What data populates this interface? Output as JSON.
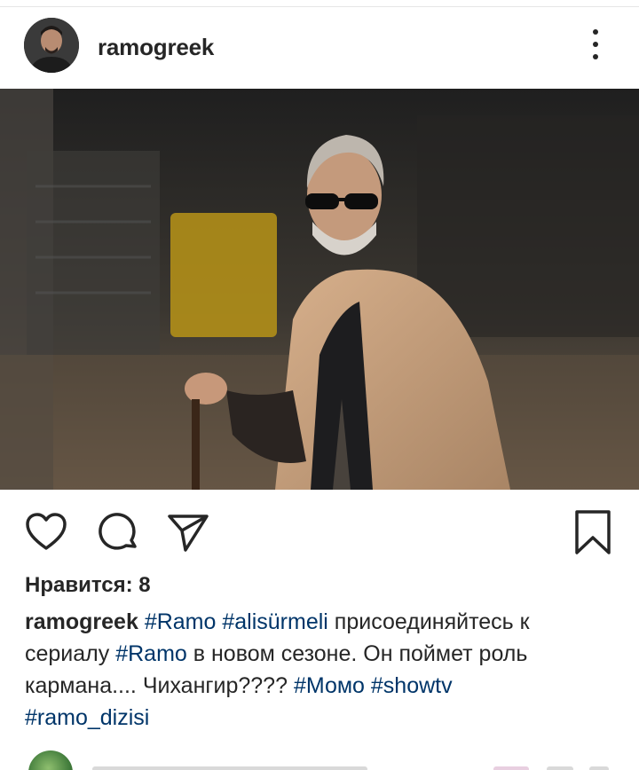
{
  "post": {
    "username": "ramogreek",
    "likes_text": "Нравится: 8",
    "caption": {
      "user": "ramogreek",
      "parts": [
        {
          "type": "tag",
          "text": "#Ramo"
        },
        {
          "type": "text",
          "text": " "
        },
        {
          "type": "tag",
          "text": "#alisürmeli"
        },
        {
          "type": "text",
          "text": " присоединяйтесь к сериалу "
        },
        {
          "type": "tag",
          "text": "#Ramo"
        },
        {
          "type": "text",
          "text": " в новом сезоне. Он поймет роль кармана.... Чихангир???? "
        },
        {
          "type": "tag",
          "text": "#Момо"
        },
        {
          "type": "text",
          "text": " "
        },
        {
          "type": "tag",
          "text": "#showtv"
        },
        {
          "type": "text",
          "text": " "
        },
        {
          "type": "tag",
          "text": "#ramo_dizisi"
        }
      ]
    }
  },
  "icons": {
    "more": "more-vertical-icon",
    "like": "heart-icon",
    "comment": "comment-icon",
    "share": "direct-share-icon",
    "save": "bookmark-icon"
  },
  "colors": {
    "text": "#262626",
    "hashtag": "#003569",
    "divider": "#e6e6e6"
  }
}
